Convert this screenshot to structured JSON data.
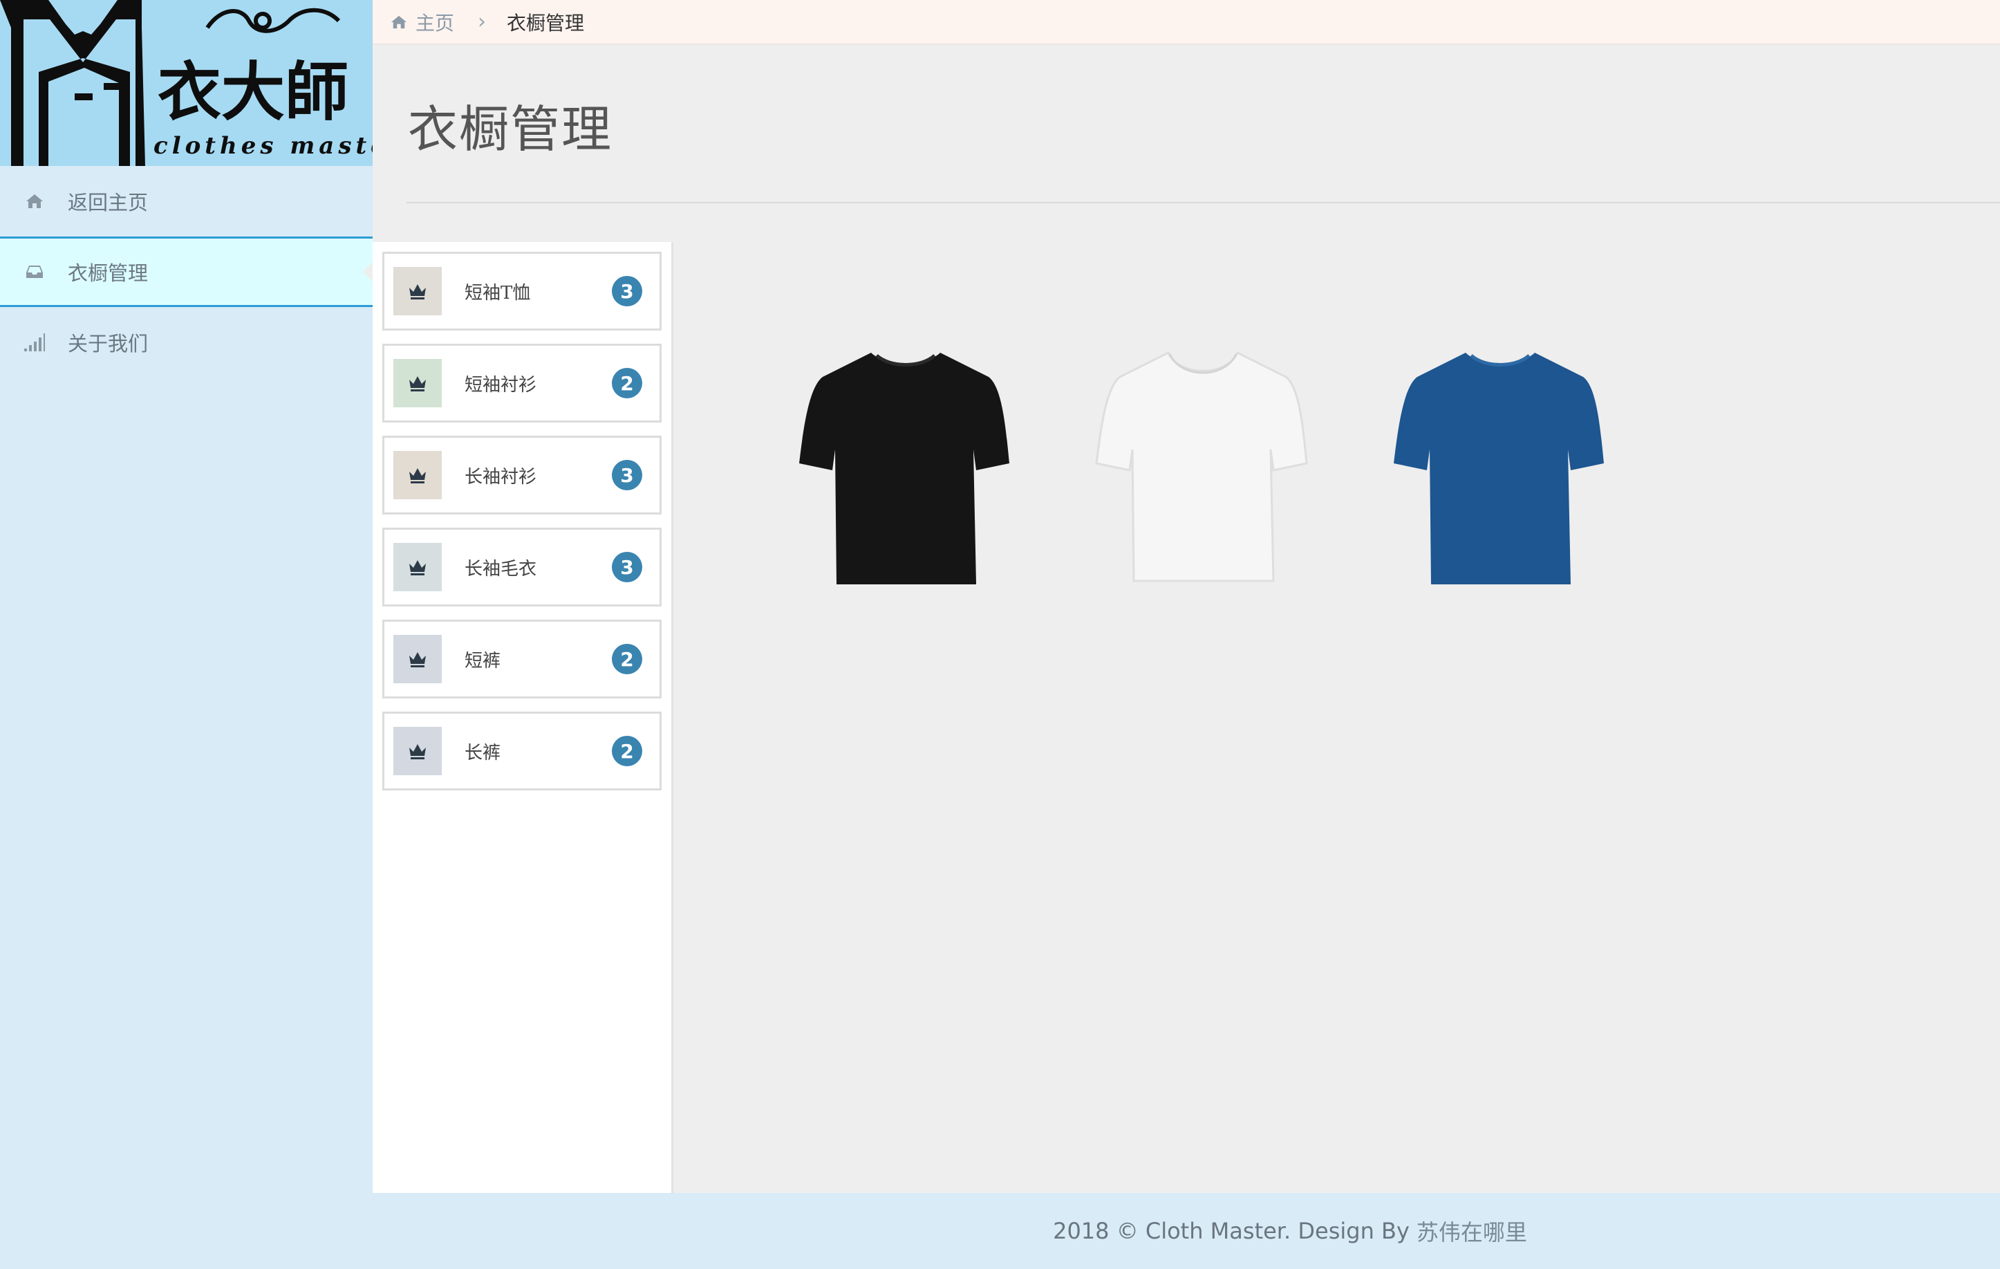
{
  "sidebar": {
    "logo": {
      "text": "衣大師",
      "subtext": "clothes master",
      "bg_color": "#a6daf2"
    },
    "items": [
      {
        "label": "返回主页",
        "icon": "home-icon",
        "active": false
      },
      {
        "label": "衣橱管理",
        "icon": "inbox-icon",
        "active": true
      },
      {
        "label": "关于我们",
        "icon": "signal-icon",
        "active": false
      }
    ]
  },
  "breadcrumb": {
    "home_icon": "home-icon",
    "home_label": "主页",
    "current": "衣橱管理"
  },
  "page": {
    "title": "衣橱管理"
  },
  "categories": [
    {
      "label": "短袖T恤",
      "count": "3",
      "icon": "crown-icon",
      "icon_bg": "#e0ddd6"
    },
    {
      "label": "短袖衬衫",
      "count": "2",
      "icon": "crown-icon",
      "icon_bg": "#d2e3d4"
    },
    {
      "label": "长袖衬衫",
      "count": "3",
      "icon": "crown-icon",
      "icon_bg": "#e2dcd2"
    },
    {
      "label": "长袖毛衣",
      "count": "3",
      "icon": "crown-icon",
      "icon_bg": "#d6dee0"
    },
    {
      "label": "短裤",
      "count": "2",
      "icon": "crown-icon",
      "icon_bg": "#d4d8e0"
    },
    {
      "label": "长裤",
      "count": "2",
      "icon": "crown-icon",
      "icon_bg": "#d4d8e0"
    }
  ],
  "clothes": [
    {
      "name": "black-tshirt",
      "color": "#151515"
    },
    {
      "name": "white-tshirt",
      "color": "#f4f4f4"
    },
    {
      "name": "blue-tshirt",
      "color": "#1d5690"
    }
  ],
  "footer": {
    "text": "2018 © Cloth Master. Design By",
    "author": "苏伟在哪里"
  },
  "colors": {
    "accent": "#2e9bd6",
    "badge": "#3a84b0",
    "sidebar_bg": "#d8ebf6"
  }
}
